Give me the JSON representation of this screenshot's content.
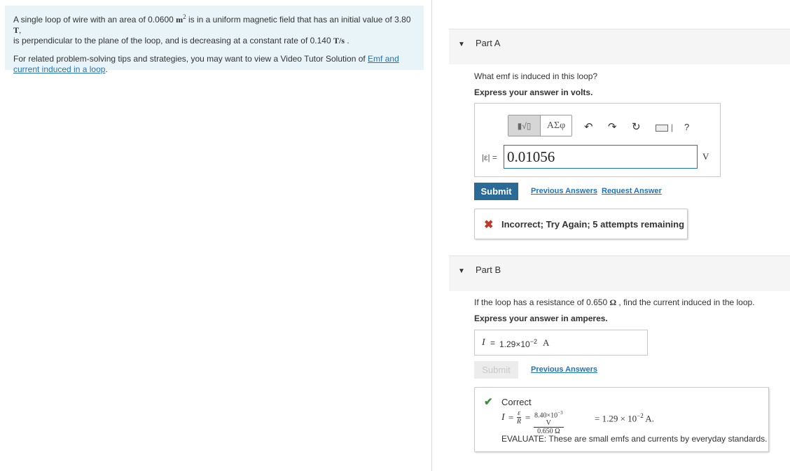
{
  "problem": {
    "line1_pre": "A single loop of wire with an area of 0.0600 ",
    "area_unit": "m",
    "area_exp": "2",
    "line1_mid": " is in a uniform magnetic field that has an initial value of 3.80 ",
    "field_unit": "T",
    "line2_pre": "is perpendicular to the plane of the loop, and is decreasing at a constant rate of 0.140 ",
    "rate_unit": "T/s",
    "tips_pre": "For related problem-solving tips and strategies, you may want to view a Video Tutor Solution of ",
    "tips_link": "Emf and current induced in a loop",
    "tips_post": "."
  },
  "part_a": {
    "title": "Part A",
    "question": "What emf is induced in this loop?",
    "instruction": "Express your answer in volts.",
    "toolbar": {
      "templates_label": "▮√▯",
      "greek_label": "ΑΣφ",
      "undo_icon": "undo-icon",
      "redo_icon": "redo-icon",
      "reset_icon": "reset-icon",
      "keyboard_icon": "keyboard-icon",
      "help_label": "?"
    },
    "answer_label": "|ε| =",
    "answer_value": "0.01056",
    "unit": "V",
    "submit_label": "Submit",
    "previous_answers_label": "Previous Answers",
    "request_answer_label": "Request Answer",
    "feedback": {
      "status": "incorrect",
      "message": "Incorrect; Try Again; 5 attempts remaining"
    }
  },
  "part_b": {
    "title": "Part B",
    "question_pre": "If the loop has a resistance of 0.650 ",
    "question_unit": "Ω",
    "question_post": " , find the current induced in the loop.",
    "instruction": "Express your answer in amperes.",
    "answer_label": "I",
    "answer_eq": "=",
    "answer_value": "1.29×10",
    "answer_exp": "−2",
    "unit": "A",
    "submit_label": "Submit",
    "previous_answers_label": "Previous Answers",
    "feedback": {
      "status": "correct",
      "title": "Correct",
      "formula_I": "I",
      "formula_eq": "=",
      "frac1_num": "ε",
      "frac1_den": "R",
      "frac2_num": "8.40×10",
      "frac2_num_exp": "−3",
      "frac2_num_unit": " V",
      "frac2_den": "0.650 Ω",
      "result_pre": "= 1.29 × 10",
      "result_exp": "−2",
      "result_unit": " A.",
      "evaluate": "EVALUATE: These are small emfs and currents by everyday standards."
    }
  },
  "colors": {
    "problem_bg": "#e8f4f8",
    "link": "#1e73be",
    "submit": "#2a6a96",
    "incorrect": "#c0392b",
    "correct": "#3c8f3c"
  }
}
